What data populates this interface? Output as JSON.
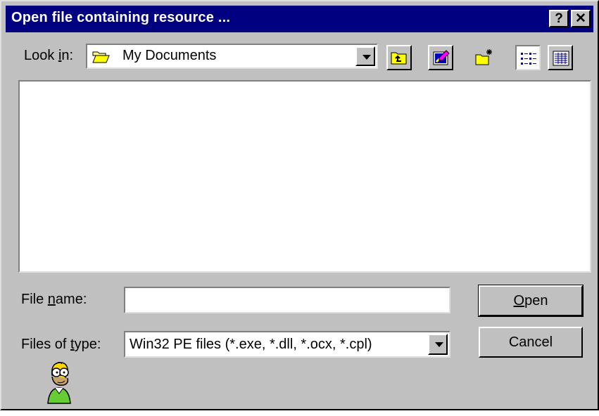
{
  "window": {
    "title": "Open file containing resource ...",
    "help_button": "?",
    "close_button": "✕"
  },
  "look_in": {
    "label_prefix": "Look ",
    "label_accel": "i",
    "label_suffix": "n:",
    "value": "My Documents",
    "icon": "open-folder-icon"
  },
  "toolbar": {
    "buttons": [
      "up-one-level-icon",
      "desktop-icon",
      "new-folder-icon",
      "list-view-icon",
      "details-view-icon"
    ]
  },
  "file_name": {
    "label_prefix": "File ",
    "label_accel": "n",
    "label_suffix": "ame:",
    "value": ""
  },
  "files_of_type": {
    "label_prefix": "Files of ",
    "label_accel": "t",
    "label_suffix": "ype:",
    "value": "Win32 PE files (*.exe, *.dll, *.ocx, *.cpl)"
  },
  "buttons": {
    "open_accel": "O",
    "open_rest": "pen",
    "cancel": "Cancel"
  },
  "mascot": "cartoon-character-icon"
}
